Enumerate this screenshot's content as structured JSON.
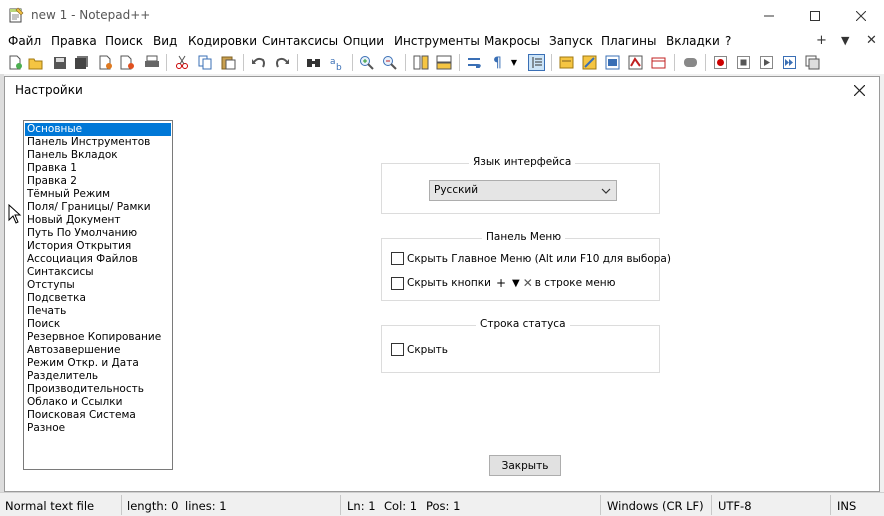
{
  "window": {
    "title": "new 1 - Notepad++"
  },
  "menu": {
    "items": [
      "Файл",
      "Правка",
      "Поиск",
      "Вид",
      "Кодировки",
      "Синтаксисы",
      "Опции",
      "Инструменты",
      "Макросы",
      "Запуск",
      "Плагины",
      "Вкладки",
      "?"
    ],
    "right_plus": "+",
    "right_down": "▼",
    "right_close": "✕"
  },
  "toolbar": {
    "icons": [
      "new-file-icon",
      "open-file-icon",
      "save-icon",
      "save-all-icon",
      "close-icon",
      "close-all-icon",
      "print-icon",
      "cut-icon",
      "copy-icon",
      "paste-icon",
      "undo-icon",
      "redo-icon",
      "find-icon",
      "replace-icon",
      "zoom-in-icon",
      "zoom-out-icon",
      "sync-vertical-icon",
      "sync-horizontal-icon",
      "word-wrap-icon",
      "show-all-chars-icon",
      "indent-guide-icon",
      "function-list-icon",
      "doc-map-icon",
      "folder-workspace-icon",
      "monitoring-icon",
      "record-macro-icon",
      "stop-macro-icon",
      "play-macro-icon",
      "run-macro-multiple-icon",
      "save-macro-icon"
    ]
  },
  "dialog": {
    "title": "Настройки",
    "categories": [
      "Основные",
      "Панель Инструментов",
      "Панель Вкладок",
      "Правка 1",
      "Правка 2",
      "Тёмный Режим",
      "Поля/ Границы/ Рамки",
      "Новый Документ",
      "Путь По Умолчанию",
      "История Открытия",
      "Ассоциация Файлов",
      "Синтаксисы",
      "Отступы",
      "Подсветка",
      "Печать",
      "Поиск",
      "Резервное Копирование",
      "Автозавершение",
      "Режим Откр. и Дата",
      "Разделитель",
      "Производительность",
      "Облако и Ссылки",
      "Поисковая Система",
      "Разное"
    ],
    "selected_index": 0,
    "language_group": {
      "label": "Язык интерфейса",
      "value": "Русский"
    },
    "menu_group": {
      "label": "Панель Меню",
      "hide_main_menu": "Скрыть Главное Меню (Alt или F10 для выбора)",
      "hide_buttons_prefix": "Скрыть кнопки",
      "hide_buttons_suffix": "в строке меню",
      "symbols": [
        "+",
        "▼",
        "✕"
      ],
      "hide_main_menu_checked": false,
      "hide_buttons_checked": false
    },
    "status_group": {
      "label": "Строка статуса",
      "hide": "Скрыть",
      "hide_checked": false
    },
    "close_button": "Закрыть"
  },
  "statusbar": {
    "file_type": "Normal text file",
    "length": "length: 0",
    "lines": "lines: 1",
    "ln": "Ln: 1",
    "col": "Col: 1",
    "pos": "Pos: 1",
    "eol": "Windows (CR LF)",
    "encoding": "UTF-8",
    "mode": "INS"
  }
}
